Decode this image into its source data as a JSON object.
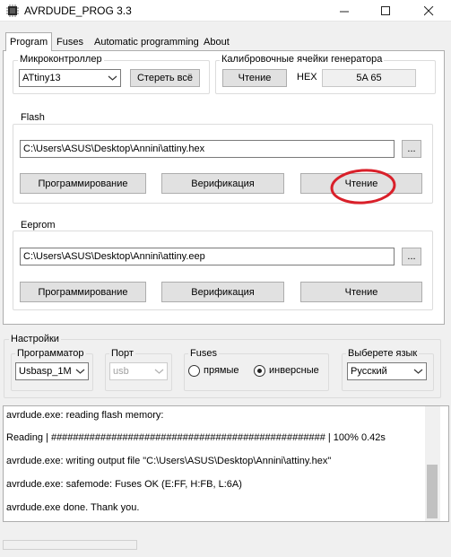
{
  "window": {
    "title": "AVRDUDE_PROG 3.3",
    "minimize_icon": "minimize-icon",
    "maximize_icon": "maximize-icon",
    "close_icon": "close-icon"
  },
  "tabs": [
    {
      "label": "Program",
      "active": true
    },
    {
      "label": "Fuses",
      "active": false
    },
    {
      "label": "Automatic programming",
      "active": false
    },
    {
      "label": "About",
      "active": false
    }
  ],
  "mcu": {
    "group_label": "Микроконтроллер",
    "selected": "ATtiny13",
    "erase_button": "Стереть всё"
  },
  "calibration": {
    "group_label": "Калибровочные ячейки генератора",
    "read_button": "Чтение",
    "hex_label": "HEX",
    "hex_value": "5A 65"
  },
  "flash": {
    "group_label": "Flash",
    "path": "C:\\Users\\ASUS\\Desktop\\Annini\\attiny.hex",
    "browse_button": "...",
    "program_button": "Программирование",
    "verify_button": "Верификация",
    "read_button": "Чтение",
    "highlight_color": "#d9202a"
  },
  "eeprom": {
    "group_label": "Eeprom",
    "path": "C:\\Users\\ASUS\\Desktop\\Annini\\attiny.eep",
    "browse_button": "...",
    "program_button": "Программирование",
    "verify_button": "Верификация",
    "read_button": "Чтение"
  },
  "settings": {
    "group_label": "Настройки",
    "programmer": {
      "label": "Программатор",
      "selected": "Usbasp_1M"
    },
    "port": {
      "label": "Порт",
      "selected": "usb"
    },
    "fuses": {
      "label": "Fuses",
      "option_direct": "прямые",
      "option_inverse": "инверсные",
      "selected": "инверсные"
    },
    "language": {
      "label": "Выберете язык",
      "selected": "Русский"
    }
  },
  "console": {
    "lines": [
      "avrdude.exe: reading flash memory:",
      "Reading | ################################################## | 100% 0.42s",
      "avrdude.exe: writing output file \"C:\\Users\\ASUS\\Desktop\\Annini\\attiny.hex\"",
      "avrdude.exe: safemode: Fuses OK (E:FF, H:FB, L:6A)",
      "avrdude.exe done.  Thank you."
    ]
  }
}
